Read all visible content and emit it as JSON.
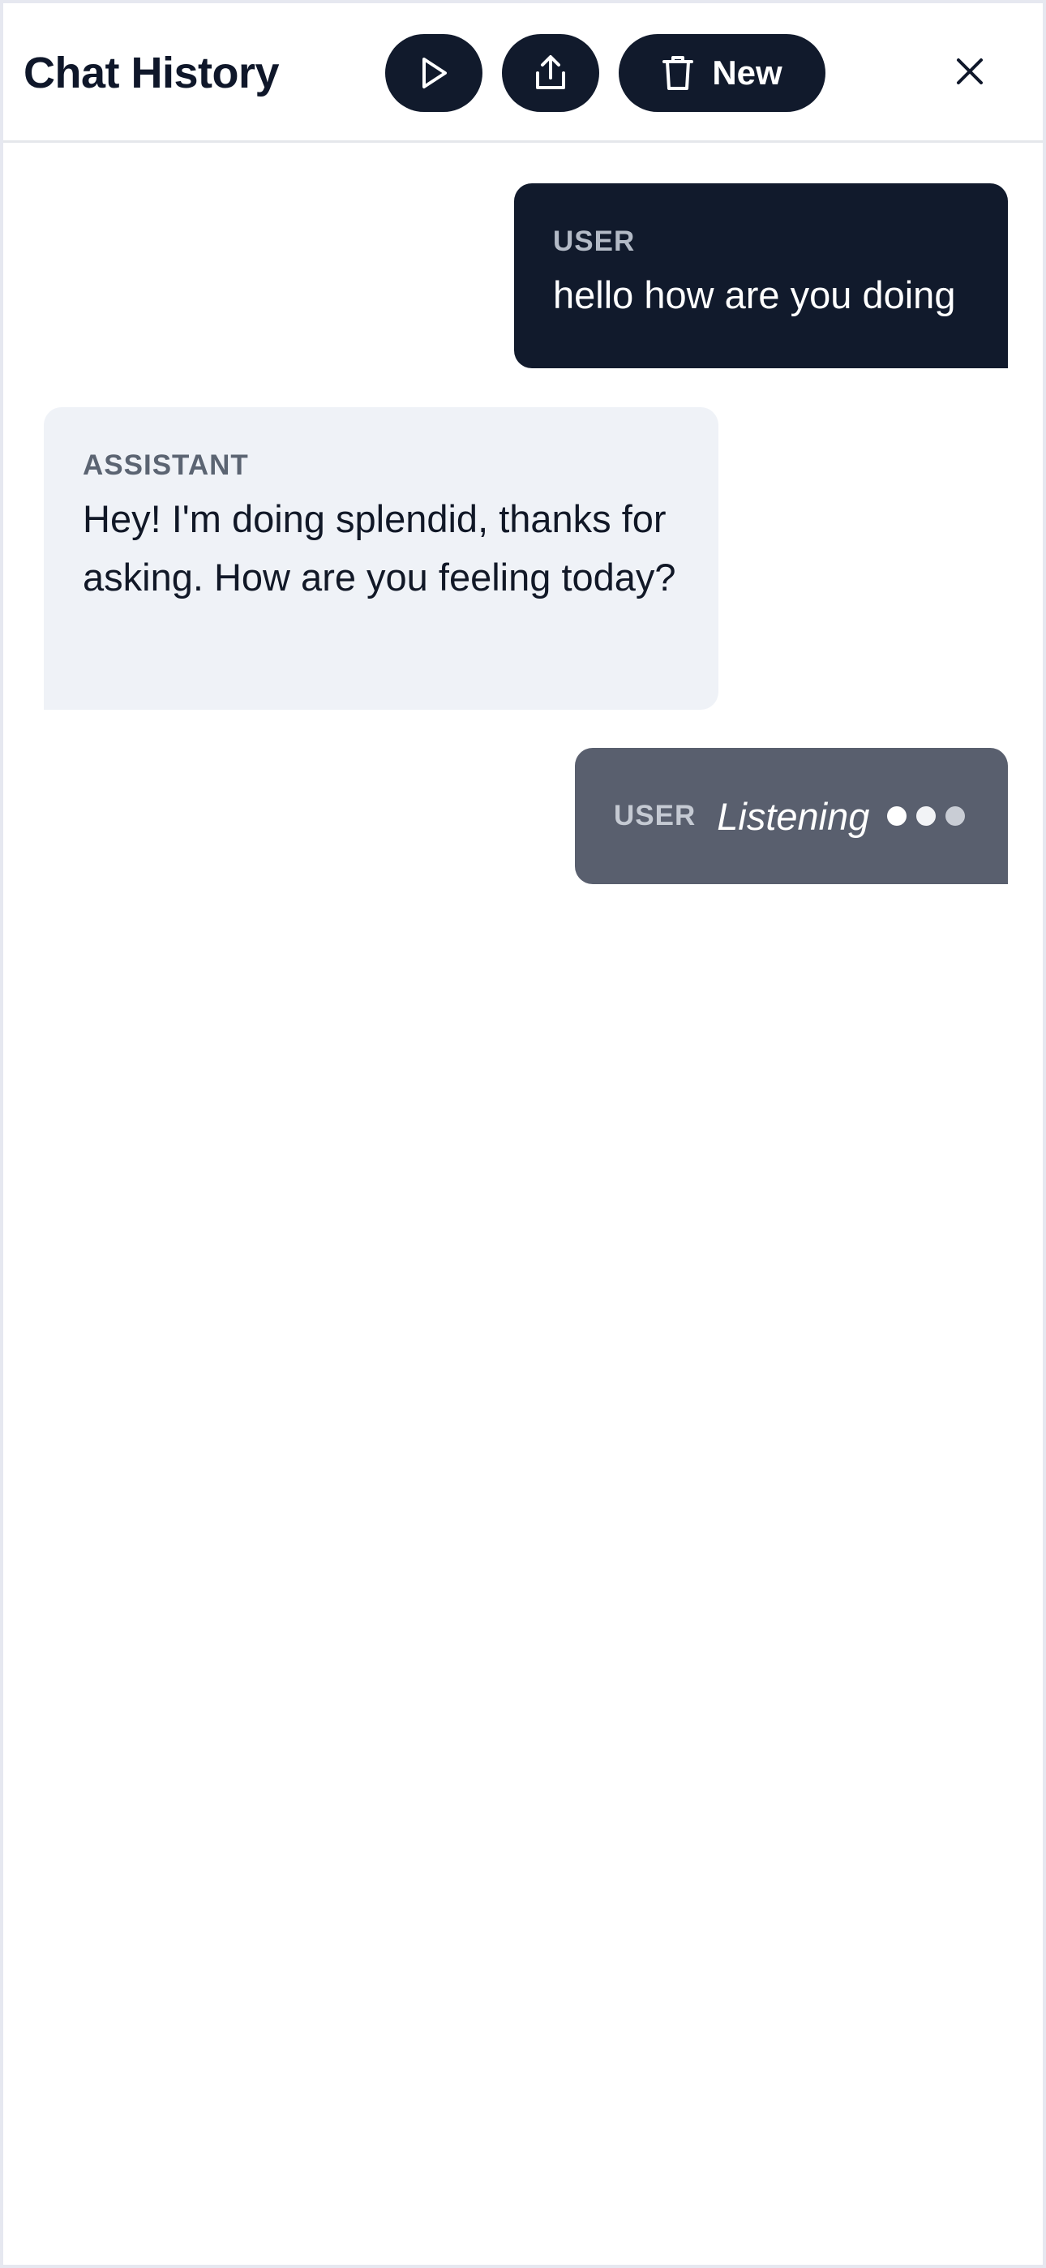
{
  "header": {
    "title": "Chat History",
    "play_icon": "play-icon",
    "share_icon": "share-icon",
    "new_button": {
      "icon": "trash-icon",
      "label": "New"
    },
    "close_icon": "close-icon"
  },
  "messages": [
    {
      "role": "USER",
      "text": "hello how are you doing"
    },
    {
      "role": "ASSISTANT",
      "text": "Hey! I'm doing splendid, thanks for asking. How are you feeling today?"
    },
    {
      "role": "USER",
      "status": "Listening"
    }
  ],
  "colors": {
    "primary_dark": "#111a2c",
    "assistant_bg": "#eff2f7",
    "listening_bg": "#595f6e",
    "text_dark": "#0f172a"
  }
}
